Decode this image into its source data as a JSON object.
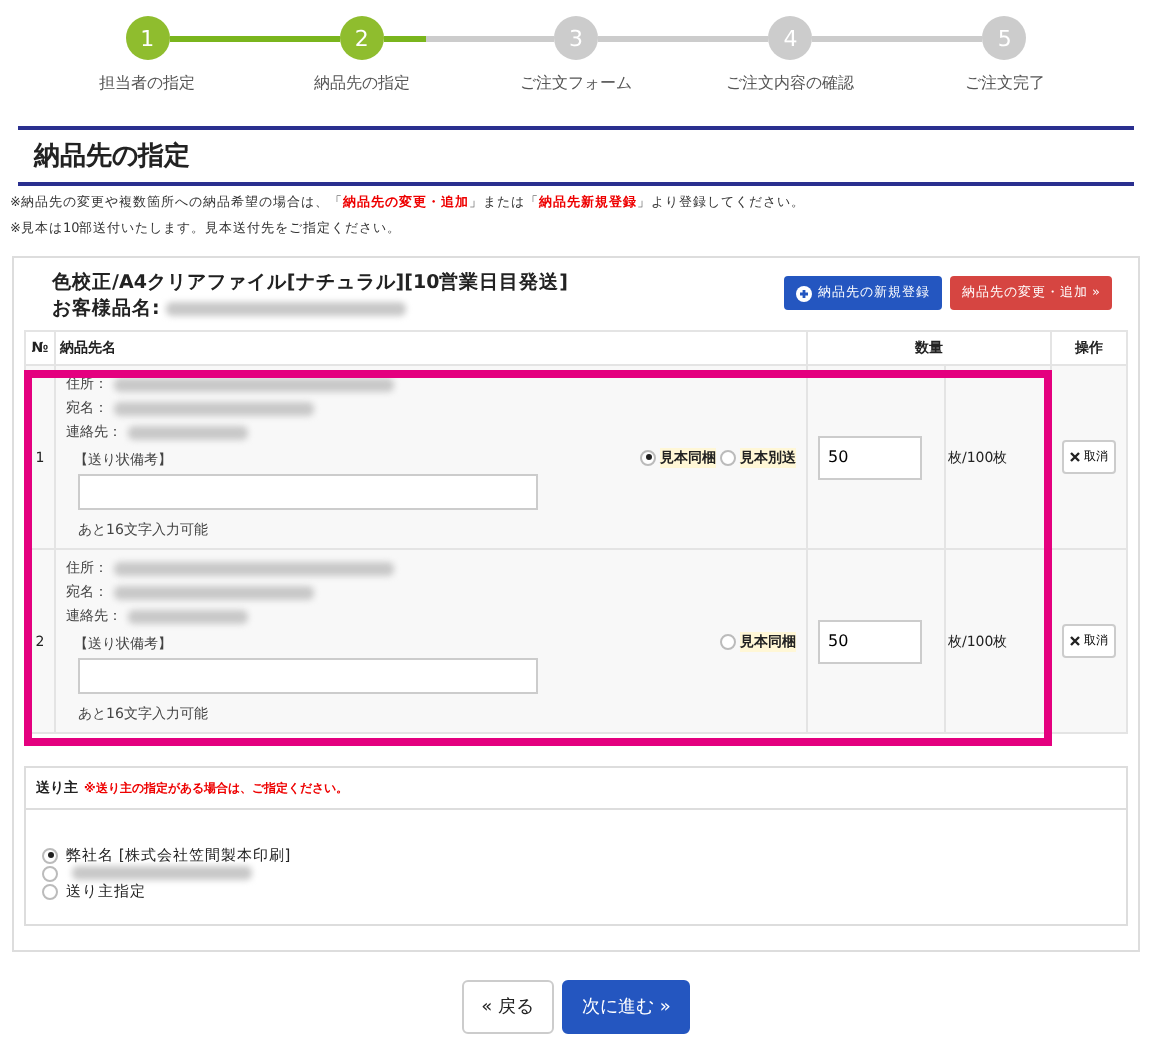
{
  "steps": [
    {
      "number": "1",
      "label": "担当者の指定",
      "completed": true
    },
    {
      "number": "2",
      "label": "納品先の指定",
      "completed": true
    },
    {
      "number": "3",
      "label": "ご注文フォーム",
      "completed": false
    },
    {
      "number": "4",
      "label": "ご注文内容の確認",
      "completed": false
    },
    {
      "number": "5",
      "label": "ご注文完了",
      "completed": false
    }
  ],
  "heading": "納品先の指定",
  "notes": [
    "※納品先の変更や複数箇所への納品希望の場合は、「**納品先の変更・追加**」または「**納品先新規登録**」より登録してください。",
    "※見本は10部送付いたします。見本送付先をご指定ください。"
  ],
  "product": {
    "title": "色校正/A4クリアファイル[ナチュラル][10営業日目発送]",
    "customer_label": "お客様品名:"
  },
  "buttons": {
    "new": "納品先の新規登録",
    "change": "納品先の変更・追加 »"
  },
  "table": {
    "columns": [
      "№",
      "納品先名",
      "数量",
      "操作"
    ],
    "rows": [
      {
        "no": "1",
        "address_label": "住所：",
        "name_label": "宛名：",
        "contact_label": "連絡先：",
        "memo_label": "【送り状備考】",
        "memo_value": "",
        "remaining": "あと16文字入力可能",
        "sample_options": [
          {
            "label": "見本同梱",
            "selected": true
          },
          {
            "label": "見本別送",
            "selected": false
          }
        ],
        "quantity": "50",
        "unit": "枚/100枚",
        "cancel": "取消"
      },
      {
        "no": "2",
        "address_label": "住所：",
        "name_label": "宛名：",
        "contact_label": "連絡先：",
        "memo_label": "【送り状備考】",
        "memo_value": "",
        "remaining": "あと16文字入力可能",
        "sample_options": [
          {
            "label": "見本同梱",
            "selected": false
          }
        ],
        "quantity": "50",
        "unit": "枚/100枚",
        "cancel": "取消"
      }
    ],
    "highlight_frame": true
  },
  "sender": {
    "title": "送り主",
    "note": "※送り主の指定がある場合は、ご指定ください。",
    "options": [
      {
        "kind": "text",
        "label": "弊社名 [株式会社笠間製本印刷]",
        "selected": true
      },
      {
        "kind": "redacted",
        "selected": false
      },
      {
        "kind": "text",
        "label": "送り主指定",
        "selected": false
      }
    ]
  },
  "nav": {
    "back": "« 戻る",
    "next": "次に進む »"
  }
}
